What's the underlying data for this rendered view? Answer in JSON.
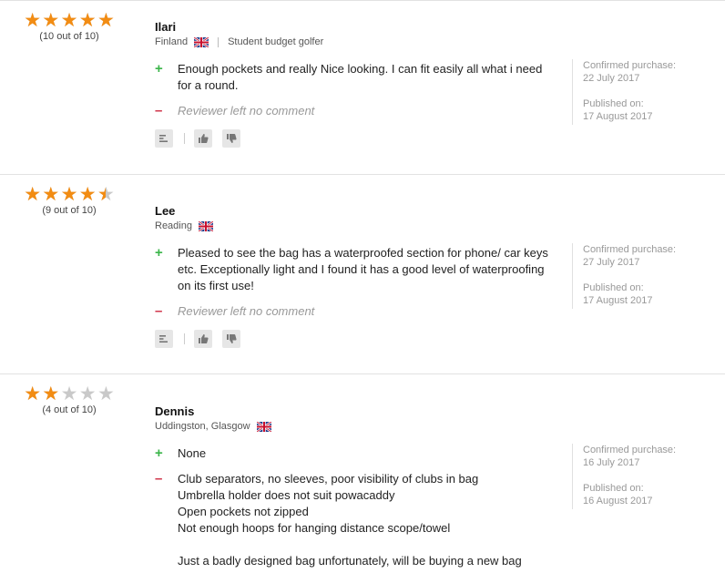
{
  "reviews": [
    {
      "stars": 5,
      "score": "(10 out of 10)",
      "name": "Ilari",
      "location": "Finland",
      "descriptor": "Student budget golfer",
      "positive": "Enough pockets and really Nice looking. I can fit easily all what i need\nfor a round.",
      "negative": "Reviewer left no comment",
      "confirmed_label": "Confirmed purchase:",
      "confirmed_date": "22 July 2017",
      "published_label": "Published on:",
      "published_date": "17 August 2017"
    },
    {
      "stars": 4.5,
      "score": "(9 out of 10)",
      "name": "Lee",
      "location": "Reading",
      "positive": "Pleased to see the bag has a waterproofed section for phone/ car keys\netc. Exceptionally light and I found it has a good level of waterproofing\non its first use!",
      "negative": "Reviewer left no comment",
      "confirmed_label": "Confirmed purchase:",
      "confirmed_date": "27 July 2017",
      "published_label": "Published on:",
      "published_date": "17 August 2017"
    },
    {
      "stars": 2,
      "score": "(4 out of 10)",
      "name": "Dennis",
      "location": "Uddingston, Glasgow",
      "positive": "None",
      "negative": "Club separators, no sleeves, poor visibility of clubs in bag\nUmbrella holder does not suit powacaddy\nOpen pockets not zipped\nNot enough hoops for hanging distance scope/towel\n\nJust a badly designed bag unfortunately, will be buying a new bag",
      "confirmed_label": "Confirmed purchase:",
      "confirmed_date": "16 July 2017",
      "published_label": "Published on:",
      "published_date": "16 August 2017"
    }
  ],
  "colors": {
    "star_on": "#f28c13",
    "star_off": "#c9c9c9",
    "plus": "#3bb54a",
    "minus": "#d0344a"
  },
  "icons": {
    "expand": "comment-lines-icon",
    "up": "thumbs-up-icon",
    "down": "thumbs-down-icon",
    "flag": "uk-flag-icon"
  }
}
